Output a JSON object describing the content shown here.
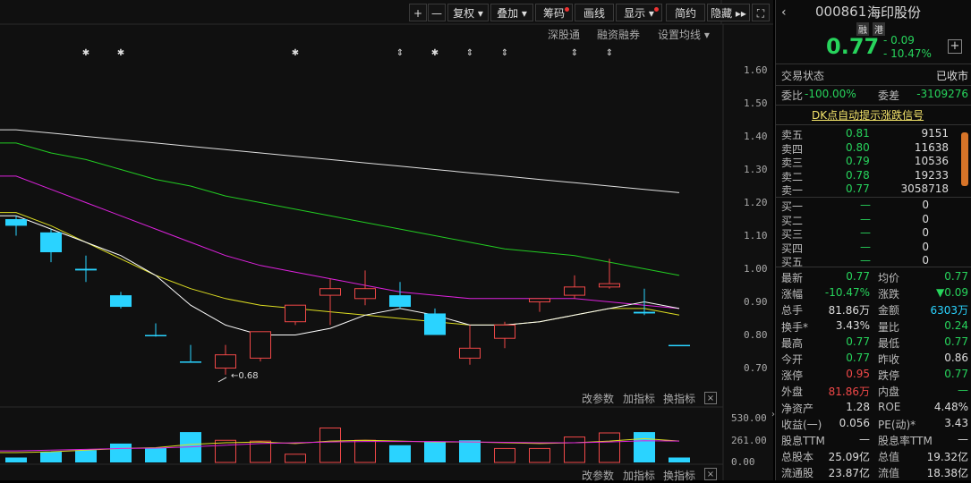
{
  "toolbar": {
    "buttons": [
      {
        "id": "plus",
        "label": "+",
        "dot": false
      },
      {
        "id": "minus",
        "label": "—",
        "dot": false
      },
      {
        "id": "fuquan",
        "label": "复权 ▾",
        "dot": false
      },
      {
        "id": "diejia",
        "label": "叠加 ▾",
        "dot": false
      },
      {
        "id": "chouma",
        "label": "筹码",
        "dot": true
      },
      {
        "id": "huaxian",
        "label": "画线",
        "dot": false
      },
      {
        "id": "xianshi",
        "label": "显示 ▾",
        "dot": true
      },
      {
        "id": "jianyue",
        "label": "简约",
        "dot": false
      },
      {
        "id": "yincang",
        "label": "隐藏 ▸▸",
        "dot": false
      },
      {
        "id": "fullscreen",
        "label": "⛶",
        "dot": false
      }
    ],
    "subtabs": [
      "深股通",
      "融资融券",
      "设置均线 ▾"
    ]
  },
  "markers": [
    "✱",
    "✱",
    "✱",
    "⇕",
    "✱",
    "⇕",
    "⇕",
    "⇕",
    "⇕"
  ],
  "chart_data": {
    "type": "candlestick",
    "price_axis": {
      "ticks": [
        "1.60",
        "1.50",
        "1.40",
        "1.30",
        "1.20",
        "1.10",
        "1.00",
        "0.90",
        "0.80",
        "0.70"
      ],
      "ylim": [
        0.65,
        1.65
      ]
    },
    "low_annotation": "0.68",
    "candles": [
      {
        "open": 1.13,
        "close": 1.15,
        "high": 1.16,
        "low": 1.1,
        "color": "cyan"
      },
      {
        "open": 1.11,
        "close": 1.05,
        "high": 1.12,
        "low": 1.02,
        "color": "cyan"
      },
      {
        "open": 1.0,
        "close": 0.995,
        "high": 1.04,
        "low": 0.96,
        "color": "cyan"
      },
      {
        "open": 0.92,
        "close": 0.885,
        "high": 0.93,
        "low": 0.88,
        "color": "cyan"
      },
      {
        "open": 0.8,
        "close": 0.8,
        "high": 0.835,
        "low": 0.795,
        "color": "cyan"
      },
      {
        "open": 0.72,
        "close": 0.72,
        "high": 0.77,
        "low": 0.72,
        "color": "cyan"
      },
      {
        "open": 0.7,
        "close": 0.74,
        "high": 0.77,
        "low": 0.68,
        "color": "red"
      },
      {
        "open": 0.73,
        "close": 0.81,
        "high": 0.81,
        "low": 0.72,
        "color": "red"
      },
      {
        "open": 0.84,
        "close": 0.89,
        "high": 0.89,
        "low": 0.83,
        "color": "red"
      },
      {
        "open": 0.92,
        "close": 0.94,
        "high": 0.97,
        "low": 0.83,
        "color": "red"
      },
      {
        "open": 0.91,
        "close": 0.94,
        "high": 0.995,
        "low": 0.89,
        "color": "red"
      },
      {
        "open": 0.92,
        "close": 0.885,
        "high": 0.96,
        "low": 0.88,
        "color": "cyan"
      },
      {
        "open": 0.865,
        "close": 0.8,
        "high": 0.88,
        "low": 0.8,
        "color": "cyan"
      },
      {
        "open": 0.73,
        "close": 0.76,
        "high": 0.83,
        "low": 0.71,
        "color": "red"
      },
      {
        "open": 0.79,
        "close": 0.83,
        "high": 0.84,
        "low": 0.76,
        "color": "red"
      },
      {
        "open": 0.9,
        "close": 0.91,
        "high": 0.91,
        "low": 0.87,
        "color": "red"
      },
      {
        "open": 0.92,
        "close": 0.945,
        "high": 0.98,
        "low": 0.91,
        "color": "red"
      },
      {
        "open": 0.945,
        "close": 0.955,
        "high": 1.03,
        "low": 0.94,
        "color": "red"
      },
      {
        "open": 0.87,
        "close": 0.865,
        "high": 0.94,
        "low": 0.86,
        "color": "cyan"
      },
      {
        "open": 0.77,
        "close": 0.77,
        "high": 0.77,
        "low": 0.77,
        "color": "cyan"
      }
    ],
    "ma_lines": [
      {
        "color": "#e0e0e0",
        "values": [
          1.42,
          1.41,
          1.4,
          1.39,
          1.38,
          1.37,
          1.36,
          1.35,
          1.34,
          1.33,
          1.32,
          1.31,
          1.3,
          1.29,
          1.28,
          1.27,
          1.26,
          1.25,
          1.24,
          1.23
        ]
      },
      {
        "color": "#22cc22",
        "values": [
          1.38,
          1.35,
          1.33,
          1.3,
          1.27,
          1.25,
          1.22,
          1.2,
          1.18,
          1.16,
          1.14,
          1.12,
          1.1,
          1.08,
          1.06,
          1.05,
          1.04,
          1.02,
          1.0,
          0.98
        ]
      },
      {
        "color": "#dd22dd",
        "values": [
          1.28,
          1.24,
          1.2,
          1.16,
          1.12,
          1.08,
          1.04,
          1.01,
          0.99,
          0.97,
          0.95,
          0.93,
          0.92,
          0.91,
          0.91,
          0.91,
          0.91,
          0.9,
          0.89,
          0.88
        ]
      },
      {
        "color": "#dddd22",
        "values": [
          1.17,
          1.13,
          1.08,
          1.03,
          0.98,
          0.94,
          0.91,
          0.89,
          0.88,
          0.87,
          0.86,
          0.85,
          0.84,
          0.83,
          0.83,
          0.84,
          0.86,
          0.88,
          0.88,
          0.86
        ]
      },
      {
        "color": "#ffffff",
        "values": [
          1.16,
          1.12,
          1.08,
          1.04,
          0.98,
          0.89,
          0.83,
          0.8,
          0.8,
          0.82,
          0.86,
          0.88,
          0.86,
          0.83,
          0.83,
          0.84,
          0.86,
          0.88,
          0.9,
          0.88
        ]
      }
    ],
    "volume_axis": {
      "ticks": [
        "530.00",
        "261.00",
        "0.00"
      ],
      "ylim": [
        0,
        600
      ]
    },
    "volumes": [
      {
        "value": 60,
        "color": "cyan"
      },
      {
        "value": 130,
        "color": "cyan"
      },
      {
        "value": 150,
        "color": "cyan"
      },
      {
        "value": 230,
        "color": "cyan"
      },
      {
        "value": 180,
        "color": "cyan"
      },
      {
        "value": 370,
        "color": "cyan"
      },
      {
        "value": 270,
        "color": "red"
      },
      {
        "value": 260,
        "color": "red"
      },
      {
        "value": 100,
        "color": "red"
      },
      {
        "value": 420,
        "color": "red"
      },
      {
        "value": 270,
        "color": "red"
      },
      {
        "value": 210,
        "color": "cyan"
      },
      {
        "value": 250,
        "color": "cyan"
      },
      {
        "value": 270,
        "color": "cyan"
      },
      {
        "value": 170,
        "color": "red"
      },
      {
        "value": 170,
        "color": "red"
      },
      {
        "value": 310,
        "color": "red"
      },
      {
        "value": 360,
        "color": "red"
      },
      {
        "value": 370,
        "color": "cyan"
      },
      {
        "value": 60,
        "color": "cyan"
      }
    ],
    "volume_ma": [
      {
        "color": "#dddd22",
        "values": [
          120,
          130,
          150,
          170,
          180,
          220,
          240,
          250,
          230,
          260,
          270,
          260,
          250,
          250,
          240,
          230,
          240,
          260,
          290,
          260
        ]
      },
      {
        "color": "#dd22dd",
        "values": [
          140,
          150,
          160,
          170,
          175,
          190,
          210,
          230,
          240,
          250,
          255,
          255,
          255,
          250,
          245,
          240,
          240,
          250,
          265,
          260
        ]
      }
    ]
  },
  "volume_panel": {
    "tools": [
      "改参数",
      "加指标",
      "换指标"
    ],
    "close": "×"
  },
  "bottom_panel": {
    "tools": [
      "改参数",
      "加指标",
      "换指标"
    ],
    "close": "×"
  },
  "quote": {
    "code": "000861",
    "name": "海印股份",
    "tags": [
      "融",
      "港"
    ],
    "price": "0.77",
    "change": "- 0.09",
    "change_pct": "- 10.47%",
    "add": "+",
    "trade_status_label": "交易状态",
    "trade_status": "已收市",
    "weibi_label": "委比",
    "weibi": "-100.00%",
    "weicha_label": "委差",
    "weicha": "-3109276",
    "dk_link": "DK点自动提示涨跌信号",
    "asks": [
      {
        "label": "卖五",
        "price": "0.81",
        "vol": "9151"
      },
      {
        "label": "卖四",
        "price": "0.80",
        "vol": "11638"
      },
      {
        "label": "卖三",
        "price": "0.79",
        "vol": "10536"
      },
      {
        "label": "卖二",
        "price": "0.78",
        "vol": "19233"
      },
      {
        "label": "卖一",
        "price": "0.77",
        "vol": "3058718"
      }
    ],
    "bids": [
      {
        "label": "买一",
        "price": "—",
        "vol": "0"
      },
      {
        "label": "买二",
        "price": "—",
        "vol": "0"
      },
      {
        "label": "买三",
        "price": "—",
        "vol": "0"
      },
      {
        "label": "买四",
        "price": "—",
        "vol": "0"
      },
      {
        "label": "买五",
        "price": "—",
        "vol": "0"
      }
    ],
    "stats": [
      {
        "l1": "最新",
        "v1": "0.77",
        "c1": "g",
        "l2": "均价",
        "v2": "0.77",
        "c2": "g"
      },
      {
        "l1": "涨幅",
        "v1": "-10.47%",
        "c1": "g",
        "l2": "涨跌",
        "v2": "▼0.09",
        "c2": "g"
      },
      {
        "l1": "总手",
        "v1": "81.86万",
        "c1": "w",
        "l2": "金额",
        "v2": "6303万",
        "c2": "c"
      },
      {
        "l1": "换手*",
        "v1": "3.43%",
        "c1": "w",
        "l2": "量比",
        "v2": "0.24",
        "c2": "g"
      },
      {
        "l1": "最高",
        "v1": "0.77",
        "c1": "g",
        "l2": "最低",
        "v2": "0.77",
        "c2": "g"
      },
      {
        "l1": "今开",
        "v1": "0.77",
        "c1": "g",
        "l2": "昨收",
        "v2": "0.86",
        "c2": "w"
      },
      {
        "l1": "涨停",
        "v1": "0.95",
        "c1": "r",
        "l2": "跌停",
        "v2": "0.77",
        "c2": "g"
      },
      {
        "l1": "外盘",
        "v1": "81.86万",
        "c1": "r",
        "l2": "内盘",
        "v2": "—",
        "c2": "g"
      },
      {
        "l1": "净资产",
        "v1": "1.28",
        "c1": "w",
        "l2": "ROE",
        "v2": "4.48%",
        "c2": "w"
      },
      {
        "l1": "收益(一)",
        "v1": "0.056",
        "c1": "w",
        "l2": "PE(动)*",
        "v2": "3.43",
        "c2": "w"
      },
      {
        "l1": "股息TTM",
        "v1": "—",
        "c1": "w",
        "l2": "股息率TTM",
        "v2": "—",
        "c2": "w"
      },
      {
        "l1": "总股本",
        "v1": "25.09亿",
        "c1": "w",
        "l2": "总值",
        "v2": "19.32亿",
        "c2": "w"
      },
      {
        "l1": "流通股",
        "v1": "23.87亿",
        "c1": "w",
        "l2": "流值",
        "v2": "18.38亿",
        "c2": "w"
      }
    ]
  },
  "colors": {
    "up": "#f04848",
    "down": "#2ad3ff",
    "price_down": "#27d45c"
  }
}
